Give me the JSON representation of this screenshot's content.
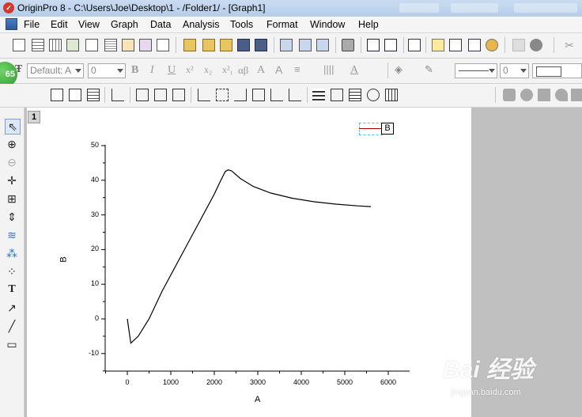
{
  "window": {
    "title": "OriginPro 8 - C:\\Users\\Joe\\Desktop\\1 - /Folder1/ - [Graph1]"
  },
  "menu": [
    "File",
    "Edit",
    "View",
    "Graph",
    "Data",
    "Analysis",
    "Tools",
    "Format",
    "Window",
    "Help"
  ],
  "format_toolbar": {
    "font": "Default: A",
    "size": "0",
    "line_width": "0",
    "labels": {
      "bold": "B",
      "italic": "I",
      "underline": "U",
      "superscript": "x²",
      "subscript": "x₂",
      "supsub": "x²₁",
      "greek": "αβ",
      "font_size_up": "A",
      "font_color": "A"
    }
  },
  "badge": {
    "text": "65"
  },
  "graph": {
    "layer_tab": "1",
    "legend_label": "B"
  },
  "chart_data": {
    "type": "line",
    "xlabel": "A",
    "ylabel": "B",
    "xlim": [
      -250,
      6600
    ],
    "ylim": [
      -15,
      50
    ],
    "xticks": [
      "0",
      "1000",
      "2000",
      "3000",
      "4000",
      "5000",
      "6000"
    ],
    "yticks": [
      "-10",
      "0",
      "10",
      "20",
      "30",
      "40",
      "50"
    ],
    "series": [
      {
        "name": "B",
        "x": [
          0,
          80,
          250,
          500,
          800,
          1100,
          1400,
          1700,
          2000,
          2150,
          2250,
          2320,
          2400,
          2600,
          2900,
          3300,
          3800,
          4300,
          4800,
          5300,
          5600
        ],
        "y": [
          0,
          -7,
          -5,
          0,
          8,
          15,
          22,
          29,
          36,
          40,
          42.5,
          43,
          42.7,
          40.5,
          38.2,
          36.3,
          34.8,
          33.8,
          33.1,
          32.6,
          32.4
        ]
      }
    ],
    "colors": {
      "line": "#000000",
      "legend_line": "#b00000"
    }
  },
  "watermark": {
    "brand": "Bai 经验",
    "url": "jingyan.baidu.com"
  }
}
